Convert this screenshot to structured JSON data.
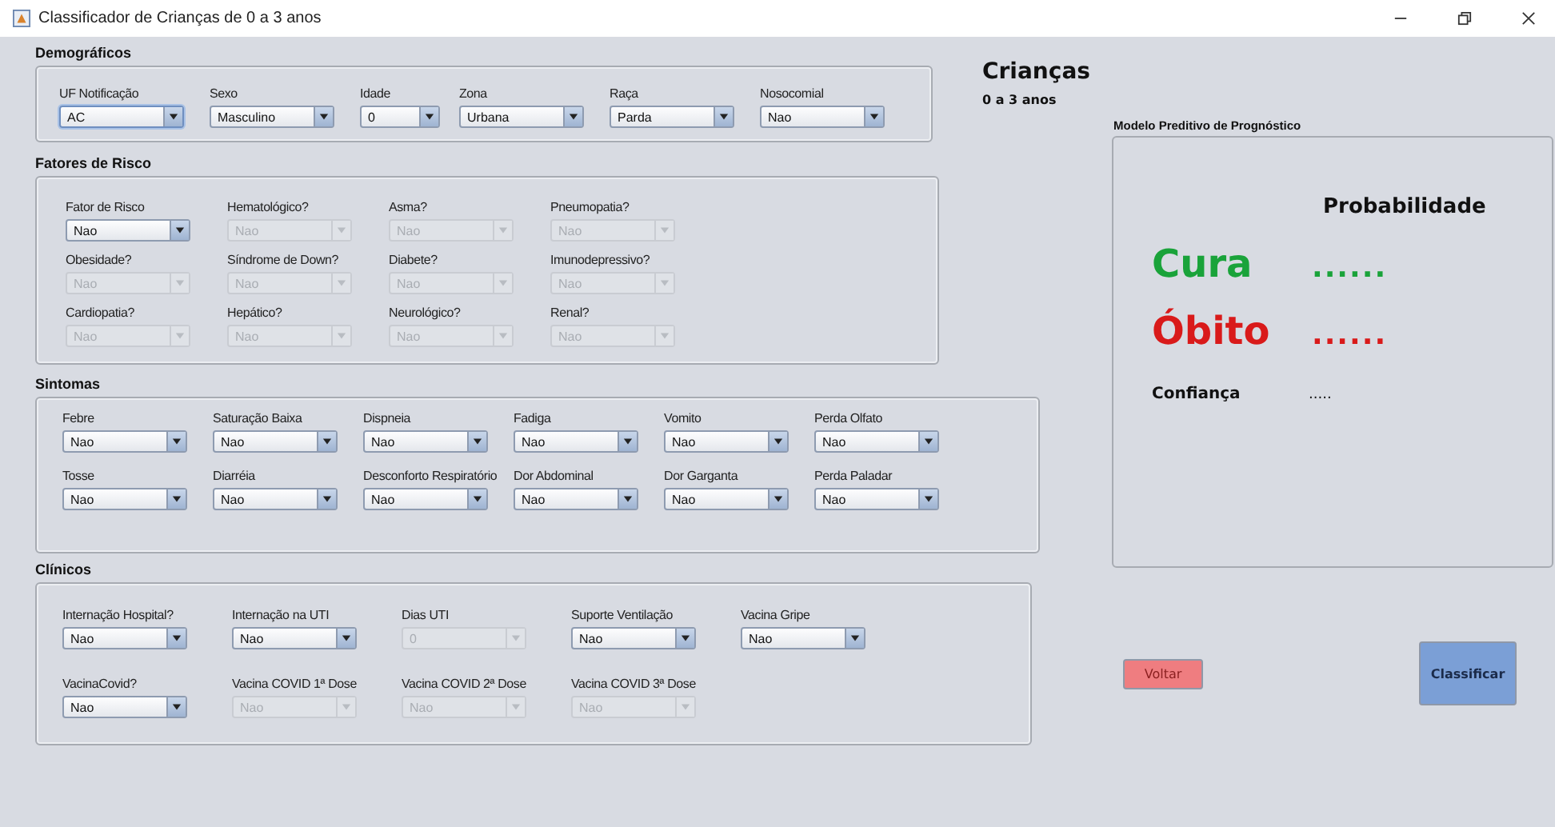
{
  "window": {
    "title": "Classificador de Crianças de 0 a 3 anos"
  },
  "sections": [
    {
      "title": "Demográficos",
      "rows": [
        [
          {
            "label": "UF Notificação",
            "value": "AC",
            "disabled": false,
            "focused": true
          },
          {
            "label": "Sexo",
            "value": "Masculino",
            "disabled": false,
            "focused": false
          },
          {
            "label": "Idade",
            "value": "0",
            "disabled": false,
            "focused": false
          },
          {
            "label": "Zona",
            "value": "Urbana",
            "disabled": false,
            "focused": false
          },
          {
            "label": "Raça",
            "value": "Parda",
            "disabled": false,
            "focused": false
          },
          {
            "label": "Nosocomial",
            "value": "Nao",
            "disabled": false,
            "focused": false
          }
        ]
      ]
    },
    {
      "title": "Fatores de Risco",
      "rows": [
        [
          {
            "label": "Fator de Risco",
            "value": "Nao",
            "disabled": false,
            "focused": false
          },
          {
            "label": "Hematológico?",
            "value": "Nao",
            "disabled": true,
            "focused": false
          },
          {
            "label": "Asma?",
            "value": "Nao",
            "disabled": true,
            "focused": false
          },
          {
            "label": "Pneumopatia?",
            "value": "Nao",
            "disabled": true,
            "focused": false
          }
        ],
        [
          {
            "label": "Obesidade?",
            "value": "Nao",
            "disabled": true,
            "focused": false
          },
          {
            "label": "Síndrome de Down?",
            "value": "Nao",
            "disabled": true,
            "focused": false
          },
          {
            "label": "Diabete?",
            "value": "Nao",
            "disabled": true,
            "focused": false
          },
          {
            "label": "Imunodepressivo?",
            "value": "Nao",
            "disabled": true,
            "focused": false
          }
        ],
        [
          {
            "label": "Cardiopatia?",
            "value": "Nao",
            "disabled": true,
            "focused": false
          },
          {
            "label": "Hepático?",
            "value": "Nao",
            "disabled": true,
            "focused": false
          },
          {
            "label": "Neurológico?",
            "value": "Nao",
            "disabled": true,
            "focused": false
          },
          {
            "label": "Renal?",
            "value": "Nao",
            "disabled": true,
            "focused": false
          }
        ]
      ]
    },
    {
      "title": "Sintomas",
      "rows": [
        [
          {
            "label": "Febre",
            "value": "Nao",
            "disabled": false,
            "focused": false
          },
          {
            "label": "Saturação Baixa",
            "value": "Nao",
            "disabled": false,
            "focused": false
          },
          {
            "label": "Dispneia",
            "value": "Nao",
            "disabled": false,
            "focused": false
          },
          {
            "label": "Fadiga",
            "value": "Nao",
            "disabled": false,
            "focused": false
          },
          {
            "label": "Vomito",
            "value": "Nao",
            "disabled": false,
            "focused": false
          },
          {
            "label": "Perda Olfato",
            "value": "Nao",
            "disabled": false,
            "focused": false
          }
        ],
        [
          {
            "label": "Tosse",
            "value": "Nao",
            "disabled": false,
            "focused": false
          },
          {
            "label": "Diarréia",
            "value": "Nao",
            "disabled": false,
            "focused": false
          },
          {
            "label": "Desconforto Respiratório",
            "value": "Nao",
            "disabled": false,
            "focused": false
          },
          {
            "label": "Dor Abdominal",
            "value": "Nao",
            "disabled": false,
            "focused": false
          },
          {
            "label": "Dor Garganta",
            "value": "Nao",
            "disabled": false,
            "focused": false
          },
          {
            "label": "Perda Paladar",
            "value": "Nao",
            "disabled": false,
            "focused": false
          }
        ]
      ]
    },
    {
      "title": "Clínicos",
      "rows": [
        [
          {
            "label": "Internação Hospital?",
            "value": "Nao",
            "disabled": false,
            "focused": false
          },
          {
            "label": "Internação na UTI",
            "value": "Nao",
            "disabled": false,
            "focused": false
          },
          {
            "label": "Dias UTI",
            "value": "0",
            "disabled": true,
            "focused": false
          },
          {
            "label": "Suporte Ventilação",
            "value": "Nao",
            "disabled": false,
            "focused": false
          },
          {
            "label": "Vacina Gripe",
            "value": "Nao",
            "disabled": false,
            "focused": false
          }
        ],
        [
          {
            "label": "VacinaCovid?",
            "value": "Nao",
            "disabled": false,
            "focused": false
          },
          {
            "label": "Vacina COVID 1ª Dose",
            "value": "Nao",
            "disabled": true,
            "focused": false
          },
          {
            "label": "Vacina COVID 2ª Dose",
            "value": "Nao",
            "disabled": true,
            "focused": false
          },
          {
            "label": "Vacina COVID 3ª Dose",
            "value": "Nao",
            "disabled": true,
            "focused": false
          }
        ]
      ]
    }
  ],
  "header": {
    "title": "Crianças",
    "subtitle": "0 a 3 anos"
  },
  "result_panel": {
    "title": "Modelo Preditivo de Prognóstico",
    "heading": "Probabilidade",
    "outcomes": [
      {
        "label": "Cura",
        "value": "......",
        "color": "#1aa33a"
      },
      {
        "label": "Óbito",
        "value": "......",
        "color": "#d91a1a"
      }
    ],
    "confidence": {
      "label": "Confiança",
      "value": "....."
    }
  },
  "buttons": [
    {
      "label": "Voltar",
      "kind": "back"
    },
    {
      "label": "Classificar",
      "kind": "primary"
    }
  ]
}
